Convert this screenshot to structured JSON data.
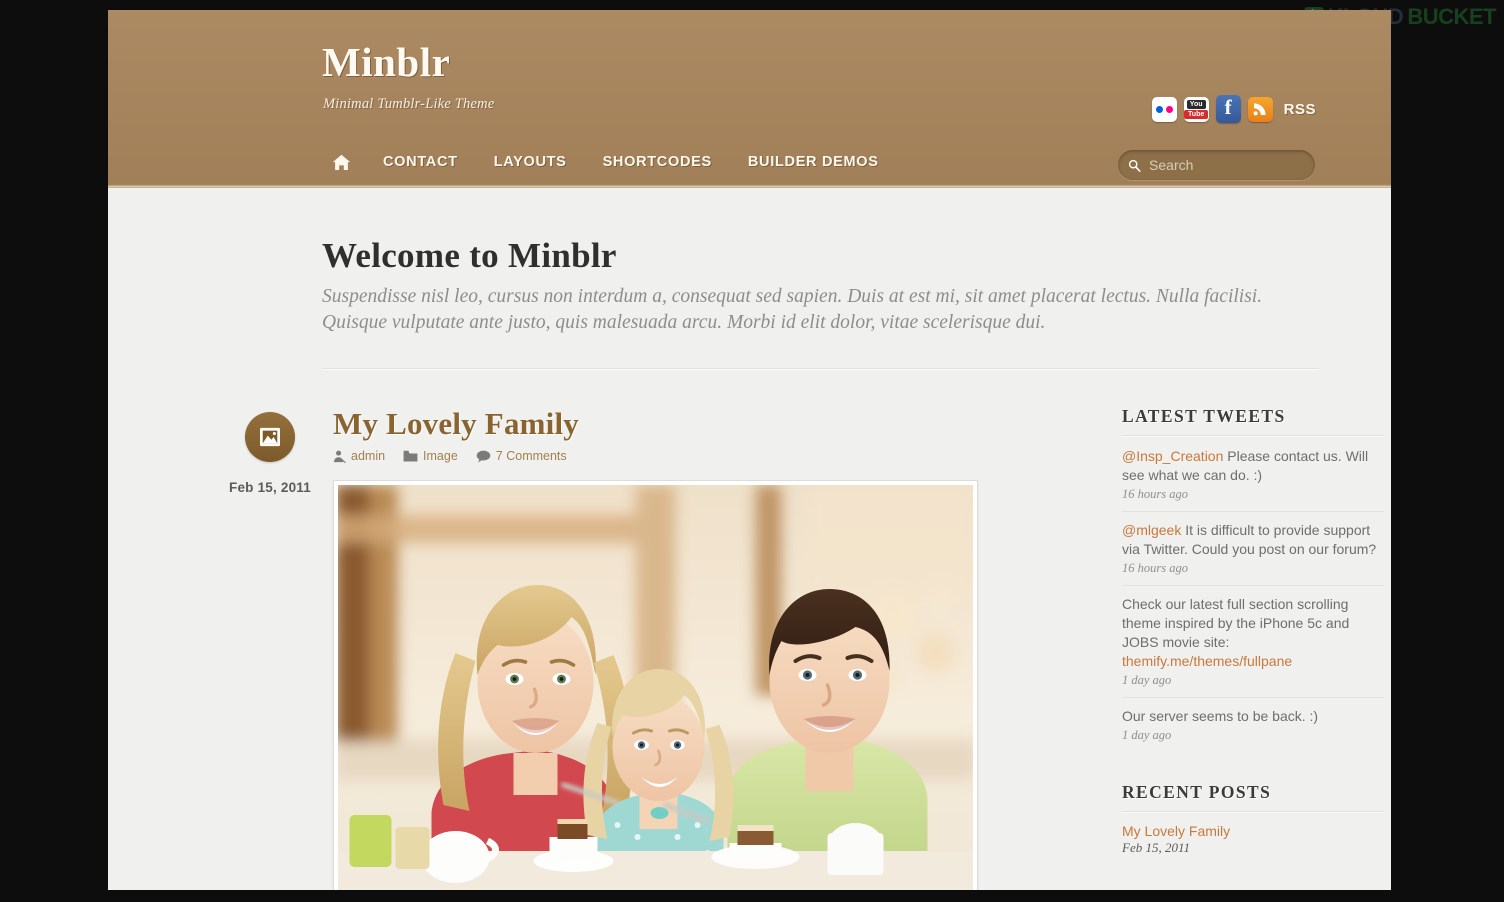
{
  "watermark": {
    "part1": "KLOUD",
    "part2": "BUCKET"
  },
  "header": {
    "site_title": "Minblr",
    "site_description": "Minimal Tumblr-Like Theme",
    "nav": [
      {
        "label": "Home",
        "icon": "home-icon",
        "is_icon": true
      },
      {
        "label": "CONTACT",
        "is_icon": false
      },
      {
        "label": "LAYOUTS",
        "is_icon": false
      },
      {
        "label": "SHORTCODES",
        "is_icon": false
      },
      {
        "label": "BUILDER DEMOS",
        "is_icon": false
      }
    ],
    "social": [
      {
        "name": "flickr-icon",
        "label": "Flickr"
      },
      {
        "name": "youtube-icon",
        "label": "YouTube",
        "top": "You",
        "bottom": "Tube"
      },
      {
        "name": "facebook-icon",
        "label": "Facebook",
        "glyph": "f"
      },
      {
        "name": "rss-icon",
        "label": "RSS"
      }
    ],
    "rss_label": "RSS",
    "search_placeholder": "Search",
    "search_value": ""
  },
  "welcome": {
    "title": "Welcome to Minblr",
    "text": "Suspendisse nisl leo, cursus non interdum a, consequat sed sapien. Duis at est mi, sit amet placerat lectus. Nulla facilisi. Quisque vulputate ante justo, quis malesuada arcu. Morbi id elit dolor, vitae scelerisque dui."
  },
  "post": {
    "format_icon": "image-format-icon",
    "date": "Feb 15, 2011",
    "title": "My Lovely Family",
    "meta": {
      "author": "admin",
      "category": "Image",
      "comments": "7 Comments"
    },
    "image_alt": "Family of three smiling at a table with desserts"
  },
  "sidebar": {
    "tweets_title": "Latest Tweets",
    "tweets": [
      {
        "handle": "@Insp_Creation",
        "text": " Please contact us. Will see what we can do. :)",
        "time": "16 hours ago"
      },
      {
        "handle": "@mlgeek",
        "text": " It is difficult to provide support via Twitter. Could you post on our forum?",
        "time": "16 hours ago"
      },
      {
        "handle": "",
        "text": "Check our latest full section scrolling theme inspired by the iPhone 5c and JOBS movie site: ",
        "link": "themify.me/themes/fullpane",
        "time": "1 day ago"
      },
      {
        "handle": "",
        "text": "Our server seems to be back. :)",
        "time": "1 day ago"
      }
    ],
    "recent_title": "Recent Posts",
    "recent_posts": [
      {
        "title": "My Lovely Family",
        "date": "Feb 15, 2011"
      }
    ]
  },
  "colors": {
    "header_bg": "#a8855c",
    "page_bg": "#f0f0ef",
    "accent_brown": "#8a6430",
    "link_orange": "#c8793b",
    "search_bg": "#8d7048"
  }
}
